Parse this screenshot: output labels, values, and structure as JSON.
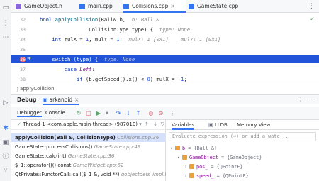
{
  "tabs": [
    {
      "label": "GameObject.h",
      "active": false,
      "icon_color": "#8a66d9"
    },
    {
      "label": "main.cpp",
      "active": false,
      "icon_color": "#3574f0"
    },
    {
      "label": "Collisions.cpp",
      "active": true,
      "icon_color": "#3574f0"
    },
    {
      "label": "GameState.cpp",
      "active": false,
      "icon_color": "#3574f0"
    }
  ],
  "editor": {
    "lines": [
      {
        "num": "32",
        "parts": [
          [
            "kw",
            "bool "
          ],
          [
            "fn",
            "applyCollision"
          ],
          [
            "",
            "(Ball& b,  "
          ],
          [
            "hint",
            "b: Ball &"
          ]
        ]
      },
      {
        "num": "33",
        "parts": [
          [
            "",
            "                CollisionType type) {  "
          ],
          [
            "hint",
            "type: None"
          ]
        ]
      },
      {
        "num": "34",
        "parts": [
          [
            "",
            "    "
          ],
          [
            "kw",
            "int "
          ],
          [
            "",
            "mulX = "
          ],
          [
            "num",
            "1"
          ],
          [
            "",
            ", mulY = "
          ],
          [
            "num",
            "1"
          ],
          [
            "",
            ";  "
          ],
          [
            "hint",
            "mulX: 1 [0x1]    mulY: 1 [0x1]"
          ]
        ]
      },
      {
        "num": "35",
        "parts": [
          [
            "",
            ""
          ]
        ]
      },
      {
        "num": "36",
        "parts": [
          [
            "",
            "    "
          ],
          [
            "kw",
            "switch "
          ],
          [
            "",
            "(type) {  "
          ],
          [
            "hint",
            "type: None"
          ]
        ]
      },
      {
        "num": "37",
        "parts": [
          [
            "",
            "        "
          ],
          [
            "kw",
            "case "
          ],
          [
            "var",
            "Left"
          ],
          [
            "",
            ":"
          ]
        ]
      },
      {
        "num": "38",
        "parts": [
          [
            "",
            "            "
          ],
          [
            "kw",
            "if "
          ],
          [
            "",
            "(b.getSpeed().x() < "
          ],
          [
            "num",
            "0"
          ],
          [
            "",
            ") mulX = -"
          ],
          [
            "num",
            "1"
          ],
          [
            "",
            ";"
          ]
        ]
      },
      {
        "num": "39",
        "parts": [
          [
            "",
            "            "
          ],
          [
            "kw",
            "break"
          ],
          [
            "",
            ";"
          ]
        ]
      }
    ],
    "breadcrumb": "applyCollision"
  },
  "debug": {
    "title": "Debug",
    "config": "arkanoid",
    "subtabs": [
      "Debugger",
      "Console"
    ],
    "thread": "Thread-1-<com.apple.main-thread> (987010)",
    "frames": [
      {
        "func": "applyCollision(Ball &, CollisionType)",
        "loc": "Collisions.cpp:36",
        "selected": true
      },
      {
        "func": "GameState::processCollisions()",
        "loc": "GameState.cpp:49",
        "selected": false
      },
      {
        "func": "GameState::calc(int)",
        "loc": "GameState.cpp:36",
        "selected": false
      },
      {
        "func": "$_1::operator()() const",
        "loc": "GameWidget.cpp:62",
        "selected": false
      },
      {
        "func": "QtPrivate::FunctorCall::call($_1 &, void **)",
        "loc": "qobjectdefs_impl.h:1",
        "selected": false
      }
    ]
  },
  "variables": {
    "tabs": [
      "Variables",
      "LLDB",
      "Memory View"
    ],
    "eval_placeholder": "Evaluate expression (⏎) or add a watc...",
    "rows": [
      {
        "name": "b",
        "value": "= {Ball &}",
        "indent": 0,
        "expanded": true
      },
      {
        "name": "GameObject",
        "value": "= {GameObject}",
        "indent": 1,
        "expanded": true
      },
      {
        "name": "pos_",
        "value": "= {QPointF}",
        "indent": 2,
        "expanded": false
      },
      {
        "name": "speed_",
        "value": "= {QPointF}",
        "indent": 2,
        "expanded": false
      }
    ]
  }
}
